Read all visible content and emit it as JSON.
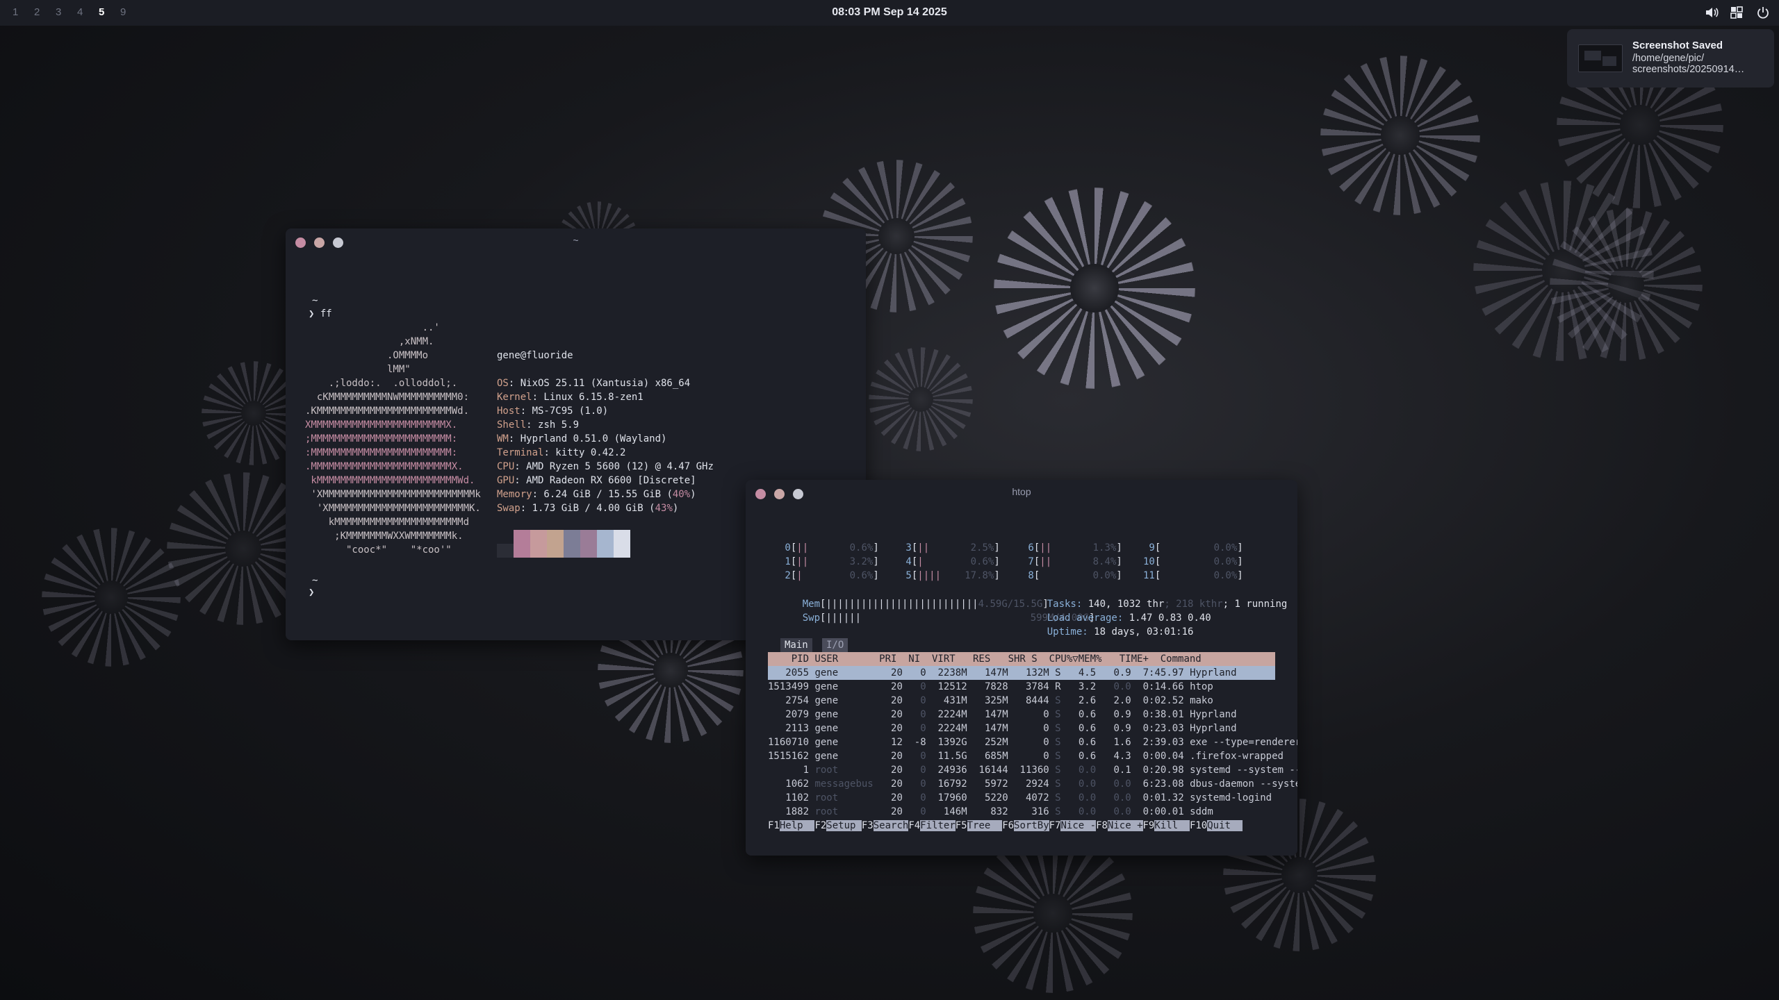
{
  "topbar": {
    "workspaces": [
      "1",
      "2",
      "3",
      "4",
      "5",
      "9"
    ],
    "active_workspace": "5",
    "clock": "08:03 PM Sep 14 2025",
    "tray_icons": [
      "volume-icon",
      "network-icon",
      "power-icon"
    ]
  },
  "notification": {
    "title": "Screenshot Saved",
    "body_line1": "/home/gene/pic/",
    "body_line2": "screenshots/20250914…"
  },
  "term1": {
    "title": "~",
    "prompt_dir": "~",
    "prompt_cmd": "❯ ff",
    "prompt2_dir": "~",
    "prompt2_cmd": "❯",
    "art": [
      "                    ..'",
      "                ,xNMM.",
      "              .OMMMMo",
      "              lMM\"",
      "    .;loddo:.  .olloddol;.",
      "  cKMMMMMMMMMMNWMMMMMMMMMM0:",
      ".KMMMMMMMMMMMMMMMMMMMMMMMWd.",
      "XMMMMMMMMMMMMMMMMMMMMMMMX.",
      ";MMMMMMMMMMMMMMMMMMMMMMMM:",
      ":MMMMMMMMMMMMMMMMMMMMMMMM:",
      ".MMMMMMMMMMMMMMMMMMMMMMMMX.",
      " kMMMMMMMMMMMMMMMMMMMMMMMMWd.",
      " 'XMMMMMMMMMMMMMMMMMMMMMMMMMMk",
      "  'XMMMMMMMMMMMMMMMMMMMMMMMMK.",
      "    kMMMMMMMMMMMMMMMMMMMMMMd",
      "     ;KMMMMMMMWXXWMMMMMMMk.",
      "       \"cooc*\"    \"*coo'\""
    ],
    "user_host": "gene@fluoride",
    "info": [
      {
        "key": "OS",
        "value": ": NixOS 25.11 (Xantusia) x86_64"
      },
      {
        "key": "Kernel",
        "value": ": Linux 6.15.8-zen1"
      },
      {
        "key": "Host",
        "value": ": MS-7C95 (1.0)"
      },
      {
        "key": "Shell",
        "value": ": zsh 5.9"
      },
      {
        "key": "WM",
        "value": ": Hyprland 0.51.0 (Wayland)"
      },
      {
        "key": "Terminal",
        "value": ": kitty 0.42.2"
      },
      {
        "key": "CPU",
        "value": ": AMD Ryzen 5 5600 (12) @ 4.47 GHz"
      },
      {
        "key": "GPU",
        "value": ": AMD Radeon RX 6600 [Discrete]"
      },
      {
        "key": "Memory",
        "value": ": 6.24 GiB / 15.55 GiB (",
        "pct": "40%",
        "tail": ")"
      },
      {
        "key": "Swap",
        "value": ": 1.73 GiB / 4.00 GiB (",
        "pct": "43%",
        "tail": ")"
      }
    ],
    "palette": [
      "#2b2d36",
      "#b47d99",
      "#c69a9c",
      "#c2a38f",
      "#7c7d96",
      "#9a7c97",
      "#a6b6cf",
      "#d9dde8"
    ]
  },
  "htop": {
    "title": "htop",
    "cpus": [
      {
        "n": "0",
        "bar": "||",
        "pct": "0.6%"
      },
      {
        "n": "1",
        "bar": "||",
        "pct": "3.2%"
      },
      {
        "n": "2",
        "bar": "|",
        "pct": "0.6%"
      },
      {
        "n": "3",
        "bar": "||",
        "pct": "2.5%"
      },
      {
        "n": "4",
        "bar": "|",
        "pct": "0.6%"
      },
      {
        "n": "5",
        "bar": "||||",
        "pct": "17.8%"
      },
      {
        "n": "6",
        "bar": "||",
        "pct": "1.3%"
      },
      {
        "n": "7",
        "bar": "||",
        "pct": "8.4%"
      },
      {
        "n": "8",
        "bar": "",
        "pct": "0.0%"
      },
      {
        "n": "9",
        "bar": "",
        "pct": "0.0%"
      },
      {
        "n": "10",
        "bar": "",
        "pct": "0.0%"
      },
      {
        "n": "11",
        "bar": "",
        "pct": "0.0%"
      }
    ],
    "mem_label": "Mem",
    "mem_bar": "||||||||||||||||||||||||||",
    "mem_val": "4.59G/15.5G",
    "swp_label": "Swp",
    "swp_bar": "||||||",
    "swp_val": "599M/4.00G",
    "tasks_label": "Tasks: ",
    "tasks_val": "140, 1032 thr",
    "tasks_kthr": "; 218 kthr",
    "tasks_running": "; 1 running",
    "load_label": "Load average: ",
    "load_val": "1.47 0.83 0.40",
    "uptime_label": "Uptime: ",
    "uptime_val": "18 days, 03:01:16",
    "tab_main": "Main",
    "tab_io": "I/O",
    "header": "    PID USER       PRI  NI  VIRT   RES   SHR S  CPU%▽MEM%   TIME+  Command",
    "rows": [
      [
        "   2055",
        "gene      ",
        " 20",
        "  0",
        " 2238M",
        "  147M",
        "  132M",
        "S",
        "  4.5",
        "  0.9",
        " 7:45.97",
        "Hyprland"
      ],
      [
        "1513499",
        "gene      ",
        " 20",
        "  0",
        " 12512",
        "  7828",
        "  3784",
        "R",
        "  3.2",
        "  0.0",
        " 0:14.66",
        "htop"
      ],
      [
        "   2754",
        "gene      ",
        " 20",
        "  0",
        "  431M",
        "  325M",
        "  8444",
        "S",
        "  2.6",
        "  2.0",
        " 0:02.52",
        "mako"
      ],
      [
        "   2079",
        "gene      ",
        " 20",
        "  0",
        " 2224M",
        "  147M",
        "     0",
        "S",
        "  0.6",
        "  0.9",
        " 0:38.01",
        "Hyprland"
      ],
      [
        "   2113",
        "gene      ",
        " 20",
        "  0",
        " 2224M",
        "  147M",
        "     0",
        "S",
        "  0.6",
        "  0.9",
        " 0:23.03",
        "Hyprland"
      ],
      [
        "1160710",
        "gene      ",
        " 12",
        " -8",
        " 1392G",
        "  252M",
        "     0",
        "S",
        "  0.6",
        "  1.6",
        " 2:39.03",
        "exe --type=renderer --en"
      ],
      [
        "1515162",
        "gene      ",
        " 20",
        "  0",
        " 11.5G",
        "  685M",
        "     0",
        "S",
        "  0.6",
        "  4.3",
        " 0:00.04",
        ".firefox-wrapped"
      ],
      [
        "      1",
        "root      ",
        " 20",
        "  0",
        " 24936",
        " 16144",
        " 11360",
        "S",
        "  0.0",
        "  0.1",
        " 0:20.98",
        "systemd --system --deser"
      ],
      [
        "   1062",
        "messagebus",
        " 20",
        "  0",
        " 16792",
        "  5972",
        "  2924",
        "S",
        "  0.0",
        "  0.0",
        " 6:23.08",
        "dbus-daemon --system --a"
      ],
      [
        "   1102",
        "root      ",
        " 20",
        "  0",
        " 17960",
        "  5220",
        "  4072",
        "S",
        "  0.0",
        "  0.0",
        " 0:01.32",
        "systemd-logind"
      ],
      [
        "   1882",
        "root      ",
        " 20",
        "  0",
        "  146M",
        "   832",
        "   316",
        "S",
        "  0.0",
        "  0.0",
        " 0:00.01",
        "sddm"
      ]
    ],
    "fkeys": [
      {
        "k": "F1",
        "l": "Help  "
      },
      {
        "k": "F2",
        "l": "Setup "
      },
      {
        "k": "F3",
        "l": "Search"
      },
      {
        "k": "F4",
        "l": "Filter"
      },
      {
        "k": "F5",
        "l": "Tree  "
      },
      {
        "k": "F6",
        "l": "SortBy"
      },
      {
        "k": "F7",
        "l": "Nice -"
      },
      {
        "k": "F8",
        "l": "Nice +"
      },
      {
        "k": "F9",
        "l": "Kill  "
      },
      {
        "k": "F10",
        "l": "Quit  "
      }
    ]
  },
  "colors": {
    "topbar_bg": "#1b1d24",
    "window_bg": "#1d1f27",
    "dot_close": "#c58ca3",
    "dot_min": "#c9a6a6",
    "dot_max": "#c7c9d3",
    "htop_header_bg": "#c7a5a0",
    "htop_select_bg": "#a6b6cf"
  }
}
